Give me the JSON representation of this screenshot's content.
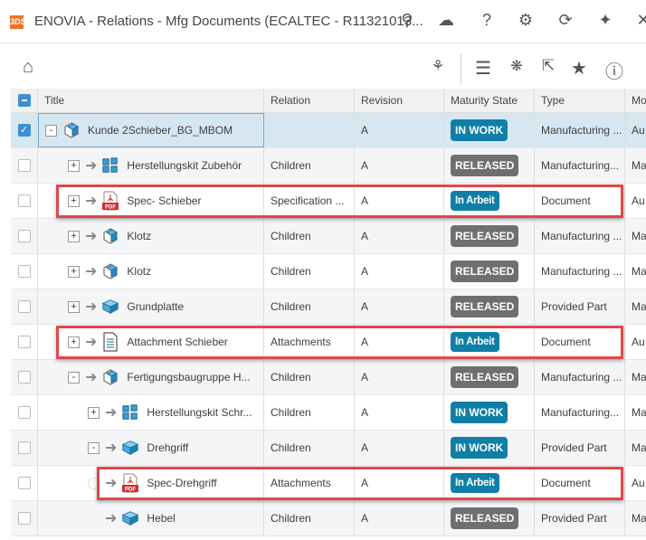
{
  "window": {
    "title": "ENOVIA - Relations - Mfg Documents (ECALTEC - R11321013...",
    "logo": "3DS",
    "icons": [
      "search-icon",
      "cloud-icon",
      "help-icon",
      "gear-icon",
      "refresh-icon",
      "pin-icon",
      "close-icon"
    ]
  },
  "toolbar": {
    "icons": [
      "home-icon",
      "tree-settings-icon",
      "list-icon",
      "network-settings-icon",
      "select-icon",
      "star-icon",
      "info-icon"
    ]
  },
  "colors": {
    "in_work": "#0f7fa6",
    "released": "#6f6f6f",
    "highlight": "#e0474c",
    "selected_row": "#d7e7f1"
  },
  "columns": [
    "Title",
    "Relation",
    "Revision",
    "Maturity State",
    "Type",
    "Mo"
  ],
  "rows": [
    {
      "title": "Kunde 2Schieber_BG_MBOM",
      "relation": "",
      "revision": "A",
      "state": "IN WORK",
      "type": "Manufacturing ...",
      "mo": "Au",
      "level": 0,
      "toggle": "-",
      "icon": "assembly-icon",
      "selected": true
    },
    {
      "title": "Herstellungskit Zubehör",
      "relation": "Children",
      "revision": "A",
      "state": "RELEASED",
      "type": "Manufacturing...",
      "mo": "Ma",
      "level": 1,
      "toggle": "+",
      "icon": "kit-icon"
    },
    {
      "title": "Spec- Schieber",
      "relation": "Specification ...",
      "revision": "A",
      "state": "In Arbeit",
      "type": "Document",
      "mo": "Au",
      "level": 1,
      "toggle": "+",
      "icon": "pdf-icon",
      "highlighted": true
    },
    {
      "title": "Klotz",
      "relation": "Children",
      "revision": "A",
      "state": "RELEASED",
      "type": "Manufacturing ...",
      "mo": "Ma",
      "level": 1,
      "toggle": "+",
      "icon": "assembly-icon"
    },
    {
      "title": "Klotz",
      "relation": "Children",
      "revision": "A",
      "state": "RELEASED",
      "type": "Manufacturing ...",
      "mo": "Ma",
      "level": 1,
      "toggle": "+",
      "icon": "assembly-icon"
    },
    {
      "title": "Grundplatte",
      "relation": "Children",
      "revision": "A",
      "state": "RELEASED",
      "type": "Provided Part",
      "mo": "Ma",
      "level": 1,
      "toggle": "+",
      "icon": "part-icon"
    },
    {
      "title": "Attachment Schieber",
      "relation": "Attachments",
      "revision": "A",
      "state": "In Arbeit",
      "type": "Document",
      "mo": "Au",
      "level": 1,
      "toggle": "+",
      "icon": "document-icon",
      "highlighted": true
    },
    {
      "title": "Fertigungsbaugruppe H...",
      "relation": "Children",
      "revision": "A",
      "state": "RELEASED",
      "type": "Manufacturing ...",
      "mo": "Ma",
      "level": 1,
      "toggle": "-",
      "icon": "assembly-icon"
    },
    {
      "title": "Herstellungskit Schr...",
      "relation": "Children",
      "revision": "A",
      "state": "IN WORK",
      "type": "Manufacturing...",
      "mo": "Ma",
      "level": 2,
      "toggle": "+",
      "icon": "kit-icon"
    },
    {
      "title": "Drehgriff",
      "relation": "Children",
      "revision": "A",
      "state": "IN WORK",
      "type": "Provided Part",
      "mo": "Ma",
      "level": 2,
      "toggle": "-",
      "icon": "part-icon"
    },
    {
      "title": "Spec-Drehgriff",
      "relation": "Attachments",
      "revision": "A",
      "state": "In Arbeit",
      "type": "Document",
      "mo": "Au",
      "level": 2,
      "toggle": "loading",
      "icon": "pdf-icon",
      "highlighted": true
    },
    {
      "title": "Hebel",
      "relation": "Children",
      "revision": "A",
      "state": "RELEASED",
      "type": "Provided Part",
      "mo": "Ma",
      "level": 2,
      "toggle": "",
      "icon": "part-icon"
    }
  ]
}
